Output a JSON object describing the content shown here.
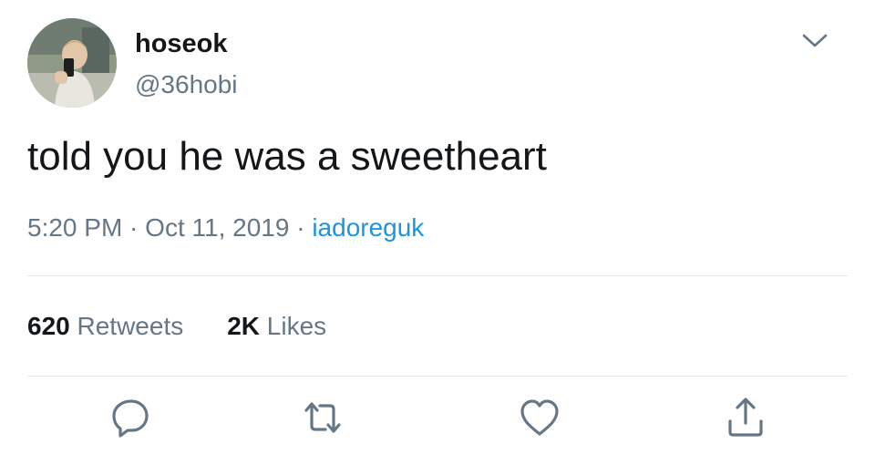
{
  "tweet": {
    "author": {
      "display_name": "hoseok",
      "handle": "@36hobi"
    },
    "text": "told you he was a sweetheart",
    "time": "5:20 PM",
    "separator": " · ",
    "date": "Oct 11, 2019",
    "source": "iadoreguk",
    "stats": {
      "retweets_count": "620",
      "retweets_label": "Retweets",
      "likes_count": "2K",
      "likes_label": "Likes"
    }
  },
  "colors": {
    "text": "#14171a",
    "secondary": "#657786",
    "link": "#1b95e0",
    "divider": "#e1e8ed"
  },
  "icons": {
    "menu": "chevron-down-icon",
    "reply": "reply-icon",
    "retweet": "retweet-icon",
    "like": "heart-icon",
    "share": "share-icon"
  }
}
